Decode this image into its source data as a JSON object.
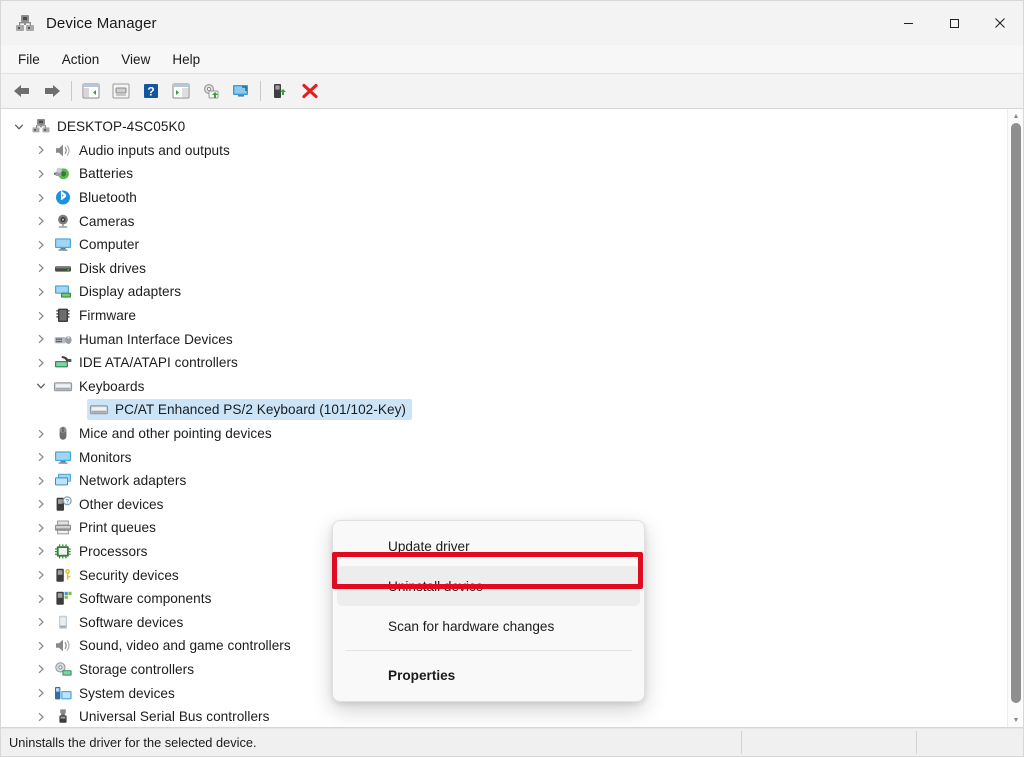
{
  "window": {
    "title": "Device Manager",
    "icon": "device-manager-icon",
    "controls": {
      "minimize": "–",
      "maximize": "□",
      "close": "✕"
    }
  },
  "menubar": {
    "items": [
      {
        "label": "File"
      },
      {
        "label": "Action"
      },
      {
        "label": "View"
      },
      {
        "label": "Help"
      }
    ]
  },
  "toolbar": {
    "buttons": [
      {
        "name": "back-icon",
        "tip": "Back"
      },
      {
        "name": "forward-icon",
        "tip": "Forward"
      },
      {
        "name": "separator-1"
      },
      {
        "name": "show-hide-console-tree-icon",
        "tip": "Show/Hide Console Tree"
      },
      {
        "name": "properties-icon",
        "tip": "Properties"
      },
      {
        "name": "help-icon",
        "tip": "Help"
      },
      {
        "name": "show-hide-action-pane-icon",
        "tip": "Show/Hide Action Pane"
      },
      {
        "name": "update-driver-icon",
        "tip": "Update Driver Software"
      },
      {
        "name": "scan-hardware-changes-icon",
        "tip": "Scan for hardware changes"
      },
      {
        "name": "separator-2"
      },
      {
        "name": "disable-device-icon",
        "tip": "Disable device"
      },
      {
        "name": "uninstall-device-icon",
        "tip": "Uninstall device"
      }
    ]
  },
  "tree": {
    "root": {
      "label": "DESKTOP-4SC05K0",
      "icon": "computer-root-icon",
      "expanded": true
    },
    "items": [
      {
        "label": "Audio inputs and outputs",
        "icon": "speaker-icon",
        "depth": 1,
        "expanded": false
      },
      {
        "label": "Batteries",
        "icon": "battery-icon",
        "depth": 1,
        "expanded": false
      },
      {
        "label": "Bluetooth",
        "icon": "bluetooth-icon",
        "depth": 1,
        "expanded": false
      },
      {
        "label": "Cameras",
        "icon": "camera-icon",
        "depth": 1,
        "expanded": false
      },
      {
        "label": "Computer",
        "icon": "monitor-icon",
        "depth": 1,
        "expanded": false
      },
      {
        "label": "Disk drives",
        "icon": "disk-drive-icon",
        "depth": 1,
        "expanded": false
      },
      {
        "label": "Display adapters",
        "icon": "display-adapter-icon",
        "depth": 1,
        "expanded": false
      },
      {
        "label": "Firmware",
        "icon": "firmware-icon",
        "depth": 1,
        "expanded": false
      },
      {
        "label": "Human Interface Devices",
        "icon": "hid-icon",
        "depth": 1,
        "expanded": false
      },
      {
        "label": "IDE ATA/ATAPI controllers",
        "icon": "ide-controller-icon",
        "depth": 1,
        "expanded": false
      },
      {
        "label": "Keyboards",
        "icon": "keyboard-icon",
        "depth": 1,
        "expanded": true
      },
      {
        "label": "PC/AT Enhanced PS/2 Keyboard (101/102-Key)",
        "icon": "keyboard-icon",
        "depth": 2,
        "selected": true
      },
      {
        "label": "Mice and other pointing devices",
        "icon": "mouse-icon",
        "depth": 1,
        "expanded": false
      },
      {
        "label": "Monitors",
        "icon": "monitor-icon",
        "depth": 1,
        "expanded": false
      },
      {
        "label": "Network adapters",
        "icon": "network-adapter-icon",
        "depth": 1,
        "expanded": false
      },
      {
        "label": "Other devices",
        "icon": "other-device-icon",
        "depth": 1,
        "expanded": false
      },
      {
        "label": "Print queues",
        "icon": "printer-icon",
        "depth": 1,
        "expanded": false
      },
      {
        "label": "Processors",
        "icon": "processor-icon",
        "depth": 1,
        "expanded": false
      },
      {
        "label": "Security devices",
        "icon": "security-device-icon",
        "depth": 1,
        "expanded": false
      },
      {
        "label": "Software components",
        "icon": "software-component-icon",
        "depth": 1,
        "expanded": false
      },
      {
        "label": "Software devices",
        "icon": "software-device-icon",
        "depth": 1,
        "expanded": false
      },
      {
        "label": "Sound, video and game controllers",
        "icon": "speaker-icon",
        "depth": 1,
        "expanded": false
      },
      {
        "label": "Storage controllers",
        "icon": "storage-controller-icon",
        "depth": 1,
        "expanded": false
      },
      {
        "label": "System devices",
        "icon": "system-device-icon",
        "depth": 1,
        "expanded": false
      },
      {
        "label": "Universal Serial Bus controllers",
        "icon": "usb-controller-icon",
        "depth": 1,
        "expanded": false
      }
    ]
  },
  "context_menu": {
    "items": [
      {
        "label": "Update driver",
        "bold": false,
        "highlighted": false
      },
      {
        "label": "Uninstall device",
        "bold": false,
        "highlighted": true
      },
      {
        "separator_after": true,
        "label": "Scan for hardware changes",
        "bold": false,
        "highlighted": false
      },
      {
        "label": "Properties",
        "bold": true,
        "highlighted": false
      }
    ]
  },
  "annotation": {
    "target": "Uninstall device",
    "color": "#e00b20"
  },
  "statusbar": {
    "text": "Uninstalls the driver for the selected device."
  },
  "colors": {
    "selection": "#cce4f7",
    "annotation_red": "#e00b20",
    "window_bg": "#f3f3f3",
    "pane_bg": "#ffffff",
    "menu_bg": "#f9f9f9",
    "menu_highlight": "#ededed"
  }
}
